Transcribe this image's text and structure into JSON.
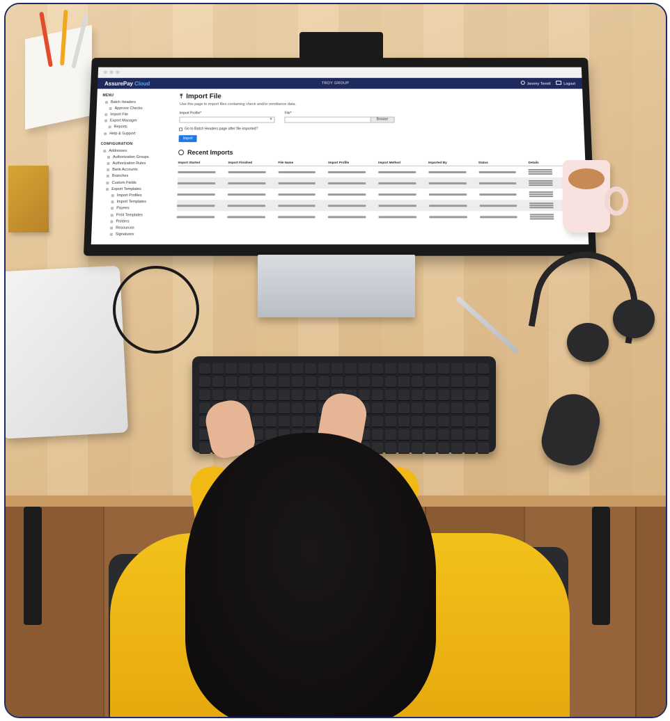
{
  "app": {
    "brand_primary": "AssurePay",
    "brand_accent": "Cloud",
    "organization": "TROY GROUP",
    "user_name": "Jeremy Terrell",
    "logout_label": "Logout"
  },
  "sidebar": {
    "menu_heading": "MENU",
    "menu_items": [
      "Batch Headers",
      "Approve Checks",
      "Import File",
      "Export Manager",
      "Reports",
      "Help & Support"
    ],
    "config_heading": "CONFIGURATION",
    "config_items": [
      "Addresses",
      "Authorization Groups",
      "Authorization Rules",
      "Bank Accounts",
      "Branches",
      "Custom Fields",
      "Export Templates",
      "Import Profiles",
      "Import Templates",
      "Payees",
      "Print Templates",
      "Printers",
      "Resources",
      "Signatures"
    ]
  },
  "import_page": {
    "title": "Import File",
    "description": "Use this page to import files containing check and/or remittance data.",
    "profile_label": "Import Profile*",
    "file_label": "File*",
    "browse_label": "Browse",
    "checkbox_label": "Go to Batch Headers page after file imported?",
    "import_button": "Import"
  },
  "recent_imports": {
    "title": "Recent Imports",
    "columns": [
      "Import Started",
      "Import Finished",
      "File Name",
      "Import Profile",
      "Import Method",
      "Imported By",
      "Status",
      "Details"
    ],
    "row_count_placeholder": [
      1,
      2,
      3,
      4,
      5
    ]
  },
  "colors": {
    "header_navy": "#1f2a5c",
    "brand_accent_blue": "#5aa6ff",
    "button_blue": "#1e77e6",
    "frame_border": "#1d2a6b"
  }
}
